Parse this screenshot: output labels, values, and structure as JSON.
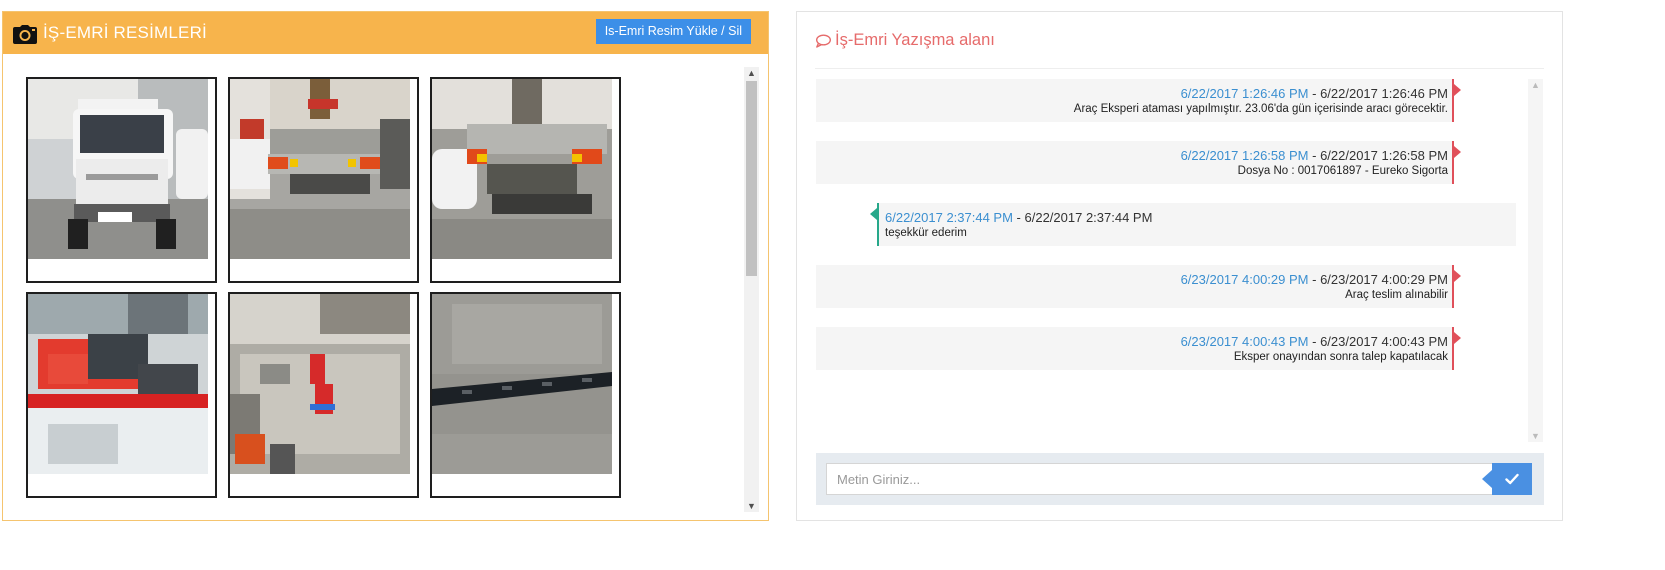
{
  "images_panel": {
    "title": "İŞ-EMRİ RESİMLERİ",
    "icon": "camera-icon",
    "upload_button": "Is-Emri Resim Yükle / Sil",
    "header_color": "#f7b44c",
    "button_color": "#3c8fe8",
    "photos": [
      {
        "name": "photo-truck-front"
      },
      {
        "name": "photo-truck-rear-1"
      },
      {
        "name": "photo-truck-rear-2"
      },
      {
        "name": "photo-parts-counter"
      },
      {
        "name": "photo-truck-bed-parts"
      },
      {
        "name": "photo-metal-bracket"
      }
    ]
  },
  "chat_panel": {
    "title": "İş-Emri Yazışma alanı",
    "icon": "comment-icon",
    "title_color": "#e66b6b",
    "messages": [
      {
        "side": "right",
        "ts1": "6/22/2017 1:26:46 PM",
        "sep": " - ",
        "ts2": "6/22/2017 1:26:46 PM",
        "text": "Araç Eksperi ataması yapılmıştır. 23.06'da gün içerisinde aracı görecektir."
      },
      {
        "side": "right",
        "ts1": "6/22/2017 1:26:58 PM",
        "sep": " - ",
        "ts2": "6/22/2017 1:26:58 PM",
        "text": "Dosya No : 0017061897 - Eureko Sigorta"
      },
      {
        "side": "left",
        "ts1": "6/22/2017 2:37:44 PM",
        "sep": " - ",
        "ts2": "6/22/2017 2:37:44 PM",
        "text": "teşekkür ederim"
      },
      {
        "side": "right",
        "ts1": "6/23/2017 4:00:29 PM",
        "sep": " - ",
        "ts2": "6/23/2017 4:00:29 PM",
        "text": "Araç teslim alınabilir"
      },
      {
        "side": "right",
        "ts1": "6/23/2017 4:00:43 PM",
        "sep": " - ",
        "ts2": "6/23/2017 4:00:43 PM",
        "text": "Eksper onayından sonra talep kapatılacak"
      }
    ],
    "input_placeholder": "Metin Giriniz...",
    "send_icon": "checkmark-icon",
    "send_color": "#4a90e2"
  }
}
